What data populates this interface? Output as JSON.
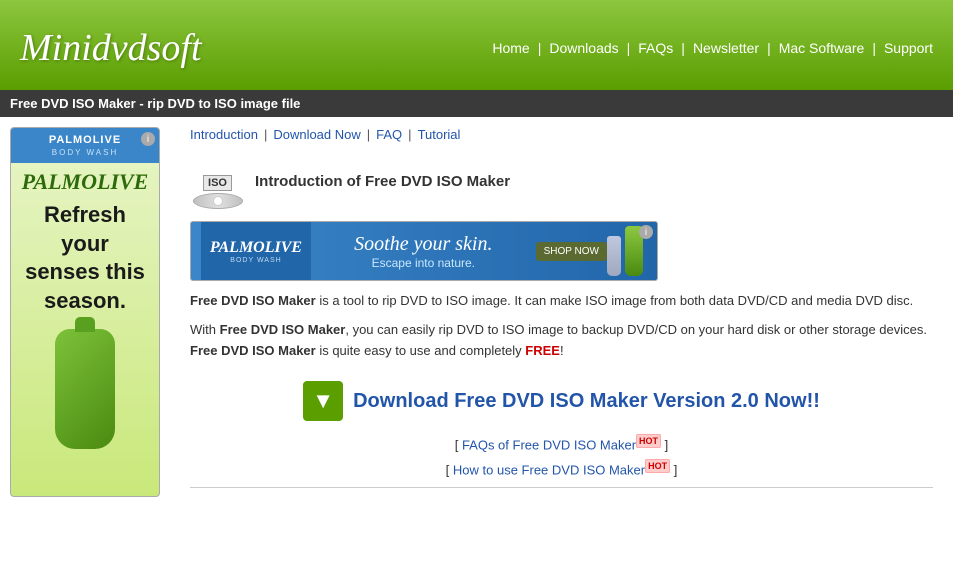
{
  "header": {
    "logo": "Minidvdsoft",
    "nav": {
      "items": [
        "Home",
        "Downloads",
        "FAQs",
        "Newsletter",
        "Mac Software",
        "Support"
      ]
    }
  },
  "breadcrumb": {
    "text": "Free DVD ISO Maker - rip DVD to ISO image file"
  },
  "sub_nav": {
    "items": [
      "Introduction",
      "Download Now",
      "FAQ",
      "Tutorial"
    ]
  },
  "product": {
    "title": "Introduction of Free DVD ISO Maker",
    "desc1": " is a tool to rip DVD to ISO image. It can make ISO image from both data DVD/CD and media DVD disc.",
    "desc1_bold": "Free DVD ISO Maker",
    "desc2_pre": "With ",
    "desc2_bold1": "Free DVD ISO Maker",
    "desc2_mid": ", you can easily rip DVD to ISO image to backup DVD/CD on your hard disk or other storage devices. ",
    "desc2_bold2": "Free DVD ISO Maker",
    "desc2_end": " is quite easy to use and completely ",
    "desc2_free": "FREE",
    "desc2_exclaim": "!"
  },
  "download": {
    "title": "Download Free DVD ISO Maker Version 2.0 Now!!",
    "icon_symbol": "▼"
  },
  "faq_links": {
    "link1_bracket_open": "[ ",
    "link1_text": "FAQs of Free DVD ISO Maker",
    "link1_hot": "HOT",
    "link1_bracket_close": " ]",
    "link2_bracket_open": "[ ",
    "link2_text": "How to use Free DVD ISO Maker",
    "link2_hot": "HOT",
    "link2_bracket_close": " ]"
  },
  "sidebar_ad": {
    "info_icon": "i",
    "brand": "PALMOLIVE",
    "brand_sub": "BODY WASH",
    "tagline": "Refresh your senses this season.",
    "bottle_color": "#4a9020"
  },
  "banner_ad": {
    "info_icon": "i",
    "brand": "PALMOLIVE",
    "brand_sub": "BODY WASH",
    "soothe": "Soothe your skin.",
    "escape": "Escape into nature.",
    "shop_btn": "SHOP NOW"
  }
}
